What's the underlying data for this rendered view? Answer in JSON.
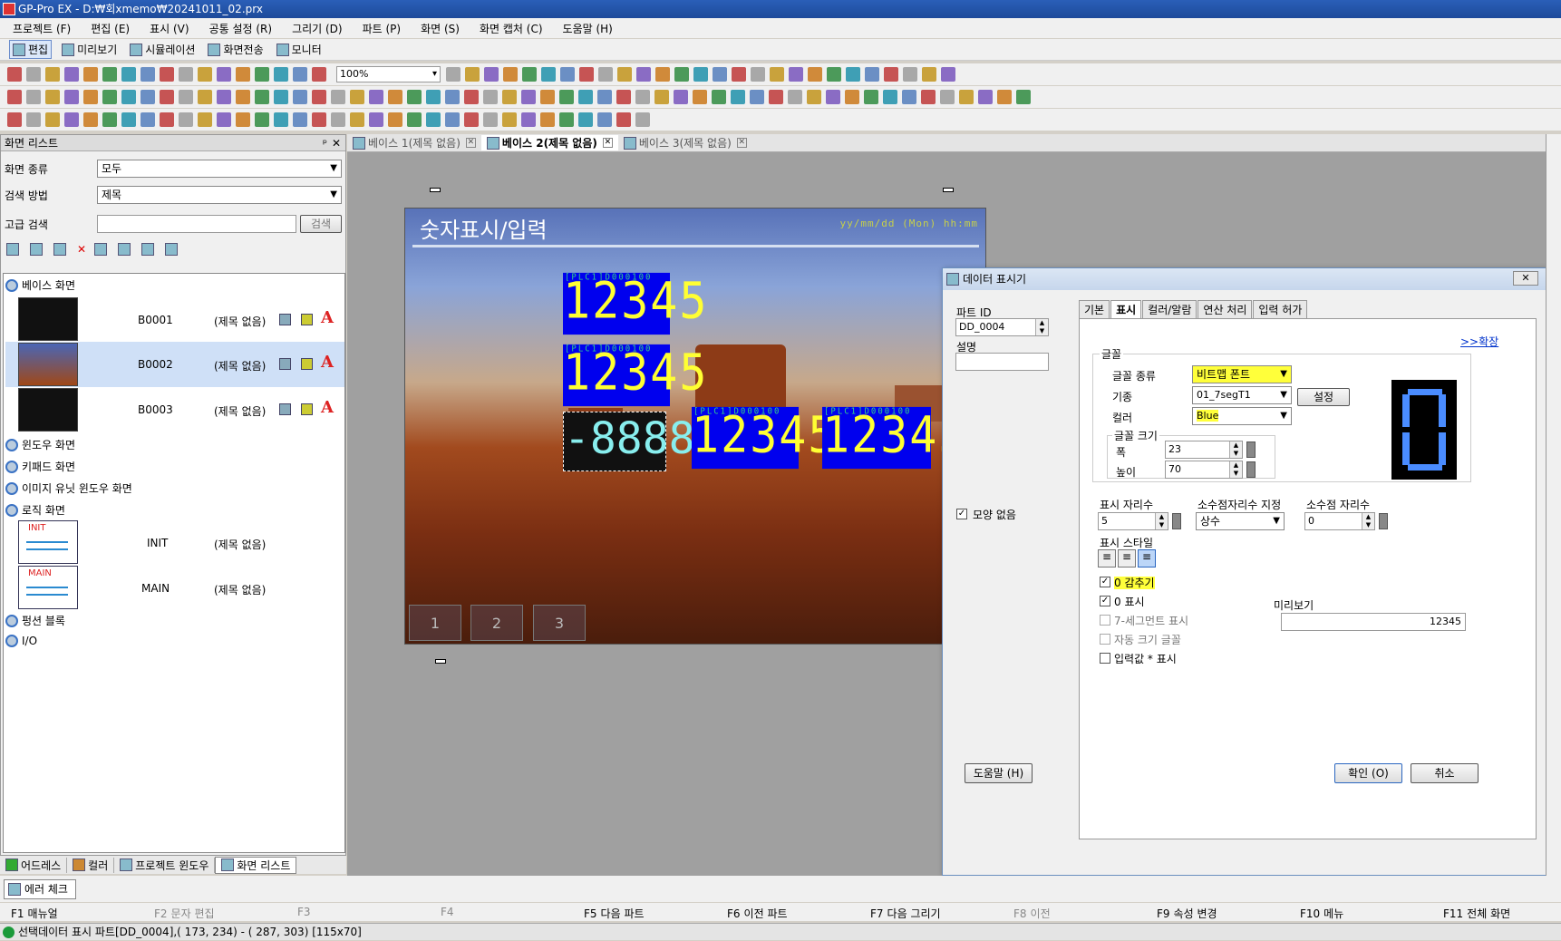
{
  "window": {
    "title": "GP-Pro EX - D:₩회xmemo₩20241011_02.prx"
  },
  "menu": [
    "프로젝트 (F)",
    "편집 (E)",
    "표시 (V)",
    "공통 설정 (R)",
    "그리기 (D)",
    "파트 (P)",
    "화면 (S)",
    "화면 캡처 (C)",
    "도움말 (H)"
  ],
  "modes": [
    "편집",
    "미리보기",
    "시뮬레이션",
    "화면전송",
    "모니터"
  ],
  "toolbar": {
    "zoom": "100%"
  },
  "screen_list": {
    "title": "화면 리스트",
    "type_label": "화면 종류",
    "type_value": "모두",
    "search_label": "검색 방법",
    "search_value": "제목",
    "adv_label": "고급 검색",
    "adv_button": "검색",
    "tree": {
      "base": "베이스 화면",
      "items": [
        {
          "id": "B0001",
          "name": "(제목 없음)"
        },
        {
          "id": "B0002",
          "name": "(제목 없음)"
        },
        {
          "id": "B0003",
          "name": "(제목 없음)"
        }
      ],
      "window": "윈도우 화면",
      "keypad": "키패드 화면",
      "image_unit": "이미지 유닛 윈도우 화면",
      "logic": "로직 화면",
      "logic_items": [
        {
          "thumb": "INIT",
          "id": "INIT",
          "name": "(제목 없음)"
        },
        {
          "thumb": "MAIN",
          "id": "MAIN",
          "name": "(제목 없음)"
        }
      ],
      "function_block": "펑션 블록",
      "io": "I/O"
    }
  },
  "bottom_tabs": [
    "어드레스",
    "컬러",
    "프로젝트 윈도우",
    "화면 리스트"
  ],
  "doc_tabs": [
    "베이스 1(제목 없음)",
    "베이스 2(제목 없음)",
    "베이스 3(제목 없음)"
  ],
  "screen": {
    "title": "숫자표시/입력",
    "date": "yy/mm/dd (Mon) hh:mm",
    "value": "12345",
    "selected_value": "-8888",
    "nav": [
      "1",
      "2",
      "3"
    ]
  },
  "dialog": {
    "title": "데이터 표시기",
    "part_id_label": "파트 ID",
    "part_id": "DD_0004",
    "desc_label": "설명",
    "noshape": "모양 없음",
    "tabs": [
      "기본",
      "표시",
      "컬러/알람",
      "연산 처리",
      "입력 허가"
    ],
    "expand": ">>확장",
    "font_group": "글꼴",
    "font_type_label": "글꼴 종류",
    "font_type": "비트맵 폰트",
    "std_label": "기종",
    "std": "01_7segT1",
    "std_btn": "설정",
    "color_label": "컬러",
    "color": "Blue",
    "size_group": "글꼴 크기",
    "width_label": "폭",
    "width": "23",
    "height_label": "높이",
    "height": "70",
    "digits_label": "표시 자리수",
    "digits": "5",
    "decspec_label": "소수점자리수 지정",
    "decspec": "상수",
    "dec_label": "소수점 자리수",
    "dec": "0",
    "style_label": "표시 스타일",
    "chk_hide0": "0 감추기",
    "chk_show0": "0 표시",
    "chk_7seg": "7-세그먼트 표시",
    "chk_auto": "자동 크기 글꼴",
    "chk_star": "입력값 * 표시",
    "preview_label": "미리보기",
    "preview": "12345",
    "help": "도움말 (H)",
    "ok": "확인 (O)",
    "cancel": "취소"
  },
  "err_check": "에러 체크",
  "fkeys": [
    {
      "k": "F1",
      "t": "매뉴얼"
    },
    {
      "k": "F2",
      "t": "문자 편집"
    },
    {
      "k": "F3",
      "t": ""
    },
    {
      "k": "F4",
      "t": ""
    },
    {
      "k": "F5",
      "t": "다음 파트"
    },
    {
      "k": "F6",
      "t": "이전 파트"
    },
    {
      "k": "F7",
      "t": "다음 그리기"
    },
    {
      "k": "F8",
      "t": "이전"
    },
    {
      "k": "F9",
      "t": "속성 변경"
    },
    {
      "k": "F10",
      "t": "메뉴"
    },
    {
      "k": "F11",
      "t": "전체 화면"
    }
  ],
  "status": "선택데이터 표시 파트[DD_0004],( 173, 234) - ( 287, 303) [115x70]"
}
